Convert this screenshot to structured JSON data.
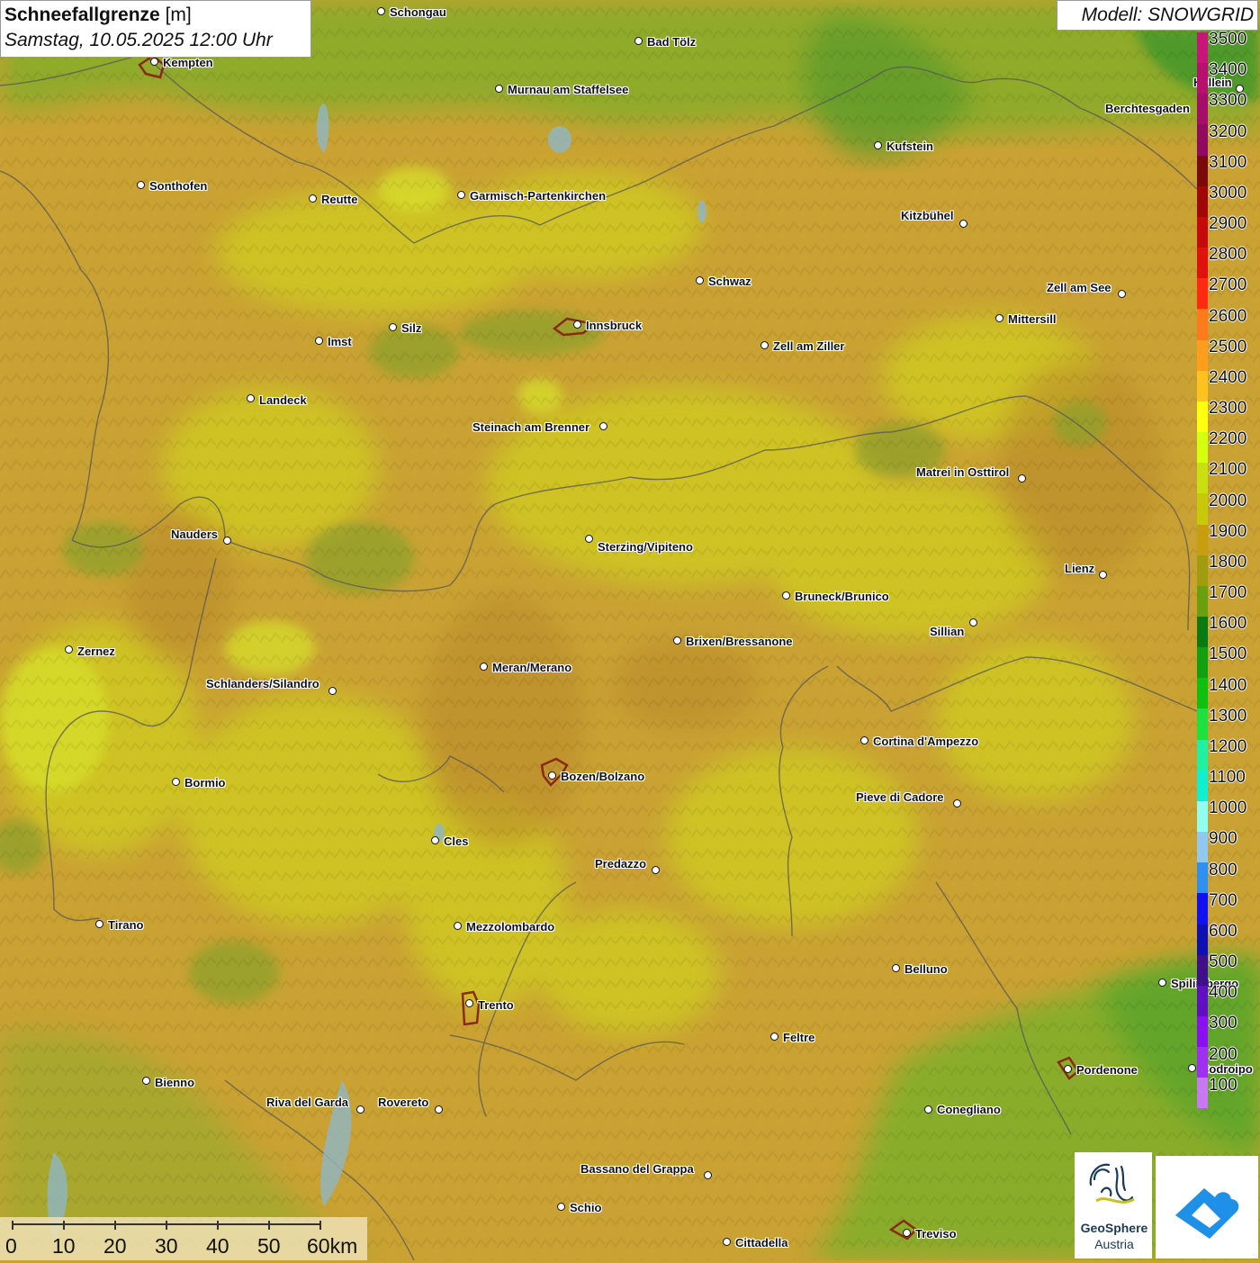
{
  "title": {
    "main": "Schneefallgrenze",
    "unit": "[m]",
    "datetime": "Samstag, 10.05.2025 12:00 Uhr"
  },
  "model_label": "Modell: SNOWGRID",
  "legend": {
    "levels": [
      {
        "value": "3500",
        "color": "#c8157a"
      },
      {
        "value": "3400",
        "color": "#b8106d"
      },
      {
        "value": "3300",
        "color": "#a50e68"
      },
      {
        "value": "3200",
        "color": "#8e0b5e"
      },
      {
        "value": "3100",
        "color": "#7a0a0a"
      },
      {
        "value": "3000",
        "color": "#a00808"
      },
      {
        "value": "2900",
        "color": "#c40a0a"
      },
      {
        "value": "2800",
        "color": "#e0120e"
      },
      {
        "value": "2700",
        "color": "#ff2a10"
      },
      {
        "value": "2600",
        "color": "#ff7a1a"
      },
      {
        "value": "2500",
        "color": "#ff9e1e"
      },
      {
        "value": "2400",
        "color": "#ffc21e"
      },
      {
        "value": "2300",
        "color": "#ffff10"
      },
      {
        "value": "2200",
        "color": "#d4ff10"
      },
      {
        "value": "2100",
        "color": "#c8e010"
      },
      {
        "value": "2000",
        "color": "#c8c80a"
      },
      {
        "value": "1900",
        "color": "#c89e10"
      },
      {
        "value": "1800",
        "color": "#a09c10"
      },
      {
        "value": "1700",
        "color": "#6aa010"
      },
      {
        "value": "1600",
        "color": "#0a7a10"
      },
      {
        "value": "1500",
        "color": "#10a010"
      },
      {
        "value": "1400",
        "color": "#10c010"
      },
      {
        "value": "1300",
        "color": "#20e040"
      },
      {
        "value": "1200",
        "color": "#20f0a0"
      },
      {
        "value": "1100",
        "color": "#10f0d0"
      },
      {
        "value": "1000",
        "color": "#90fff0"
      },
      {
        "value": "900",
        "color": "#90c8f0"
      },
      {
        "value": "800",
        "color": "#3090f0"
      },
      {
        "value": "700",
        "color": "#1010f0"
      },
      {
        "value": "600",
        "color": "#1010b0"
      },
      {
        "value": "500",
        "color": "#40108a"
      },
      {
        "value": "400",
        "color": "#6010c0"
      },
      {
        "value": "300",
        "color": "#8a10f0"
      },
      {
        "value": "200",
        "color": "#a030f0"
      },
      {
        "value": "100",
        "color": "#c878f0"
      }
    ]
  },
  "cities": [
    {
      "name": "Schongau",
      "dot": [
        424,
        13
      ],
      "label": [
        433,
        6
      ]
    },
    {
      "name": "Bad Tölz",
      "dot": [
        710,
        46
      ],
      "label": [
        719,
        39
      ]
    },
    {
      "name": "Kempten",
      "dot": [
        172,
        69
      ],
      "label": [
        181,
        62
      ]
    },
    {
      "name": "Murnau am Staffelsee",
      "dot": [
        555,
        99
      ],
      "label": [
        564,
        92
      ]
    },
    {
      "name": "Berchtesgaden",
      "dot": [
        1338,
        120
      ],
      "label": [
        1228,
        113
      ]
    },
    {
      "name": "Kufstein",
      "dot": [
        976,
        162
      ],
      "label": [
        985,
        155
      ]
    },
    {
      "name": "Sonthofen",
      "dot": [
        157,
        206
      ],
      "label": [
        166,
        199
      ]
    },
    {
      "name": "Reutte",
      "dot": [
        348,
        221
      ],
      "label": [
        357,
        214
      ]
    },
    {
      "name": "Garmisch-Partenkirchen",
      "dot": [
        513,
        217
      ],
      "label": [
        522,
        210
      ]
    },
    {
      "name": "Kitzbühel",
      "dot": [
        1071,
        249
      ],
      "label": [
        1001,
        232
      ]
    },
    {
      "name": "Schwaz",
      "dot": [
        778,
        312
      ],
      "label": [
        787,
        305
      ]
    },
    {
      "name": "Zell am See",
      "dot": [
        1247,
        327
      ],
      "label": [
        1163,
        312
      ]
    },
    {
      "name": "Mittersill",
      "dot": [
        1111,
        354
      ],
      "label": [
        1120,
        347
      ]
    },
    {
      "name": "Innsbruck",
      "dot": [
        642,
        361
      ],
      "label": [
        651,
        354
      ]
    },
    {
      "name": "Silz",
      "dot": [
        437,
        364
      ],
      "label": [
        446,
        357
      ]
    },
    {
      "name": "Imst",
      "dot": [
        355,
        379
      ],
      "label": [
        364,
        372
      ]
    },
    {
      "name": "Zell am Ziller",
      "dot": [
        850,
        384
      ],
      "label": [
        859,
        377
      ]
    },
    {
      "name": "Landeck",
      "dot": [
        279,
        443
      ],
      "label": [
        288,
        437
      ]
    },
    {
      "name": "Steinach am Brenner",
      "dot": [
        671,
        474
      ],
      "label": [
        525,
        467
      ]
    },
    {
      "name": "Matrei in Osttirol",
      "dot": [
        1136,
        532
      ],
      "label": [
        1018,
        517
      ]
    },
    {
      "name": "Nauders",
      "dot": [
        253,
        601
      ],
      "label": [
        190,
        586
      ]
    },
    {
      "name": "Sterzing/Vipiteno",
      "dot": [
        655,
        599
      ],
      "label": [
        664,
        600
      ]
    },
    {
      "name": "Lienz",
      "dot": [
        1226,
        639
      ],
      "label": [
        1183,
        624
      ]
    },
    {
      "name": "Bruneck/Brunico",
      "dot": [
        874,
        662
      ],
      "label": [
        883,
        655
      ]
    },
    {
      "name": "Sillian",
      "dot": [
        1082,
        692
      ],
      "label": [
        1033,
        694
      ]
    },
    {
      "name": "Brixen/Bressanone",
      "dot": [
        753,
        712
      ],
      "label": [
        762,
        705
      ]
    },
    {
      "name": "Zernez",
      "dot": [
        77,
        722
      ],
      "label": [
        86,
        716
      ]
    },
    {
      "name": "Meran/Merano",
      "dot": [
        538,
        741
      ],
      "label": [
        547,
        734
      ]
    },
    {
      "name": "Schlanders/Silandro",
      "dot": [
        370,
        768
      ],
      "label": [
        229,
        752
      ]
    },
    {
      "name": "Cortina d'Ampezzo",
      "dot": [
        961,
        823
      ],
      "label": [
        970,
        816
      ]
    },
    {
      "name": "Bozen/Bolzano",
      "dot": [
        614,
        862
      ],
      "label": [
        623,
        855
      ]
    },
    {
      "name": "Bormio",
      "dot": [
        196,
        869
      ],
      "label": [
        205,
        862
      ]
    },
    {
      "name": "Pieve di Cadore",
      "dot": [
        1064,
        893
      ],
      "label": [
        951,
        878
      ]
    },
    {
      "name": "Cles",
      "dot": [
        484,
        934
      ],
      "label": [
        493,
        927
      ]
    },
    {
      "name": "Predazzo",
      "dot": [
        729,
        967
      ],
      "label": [
        661,
        952
      ]
    },
    {
      "name": "Tirano",
      "dot": [
        111,
        1027
      ],
      "label": [
        120,
        1020
      ]
    },
    {
      "name": "Mezzolombardo",
      "dot": [
        509,
        1029
      ],
      "label": [
        518,
        1022
      ]
    },
    {
      "name": "Belluno",
      "dot": [
        996,
        1076
      ],
      "label": [
        1005,
        1069
      ]
    },
    {
      "name": "Spilimbergo",
      "dot": [
        1292,
        1092
      ],
      "label": [
        1301,
        1085
      ]
    },
    {
      "name": "Trento",
      "dot": [
        522,
        1115
      ],
      "label": [
        531,
        1109
      ]
    },
    {
      "name": "Feltre",
      "dot": [
        861,
        1152
      ],
      "label": [
        870,
        1145
      ]
    },
    {
      "name": "Pordenone",
      "dot": [
        1187,
        1188
      ],
      "label": [
        1196,
        1181
      ]
    },
    {
      "name": "Codroipo",
      "dot": [
        1325,
        1187
      ],
      "label": [
        1334,
        1180
      ]
    },
    {
      "name": "Bienno",
      "dot": [
        163,
        1201
      ],
      "label": [
        172,
        1195
      ]
    },
    {
      "name": "Riva del Garda",
      "dot": [
        401,
        1233
      ],
      "label": [
        296,
        1217
      ]
    },
    {
      "name": "Rovereto",
      "dot": [
        488,
        1233
      ],
      "label": [
        420,
        1217
      ]
    },
    {
      "name": "Conegliano",
      "dot": [
        1032,
        1233
      ],
      "label": [
        1041,
        1225
      ]
    },
    {
      "name": "Bassano del Grappa",
      "dot": [
        787,
        1306
      ],
      "label": [
        645,
        1291
      ]
    },
    {
      "name": "Schio",
      "dot": [
        624,
        1341
      ],
      "label": [
        633,
        1334
      ]
    },
    {
      "name": "Treviso",
      "dot": [
        1008,
        1370
      ],
      "label": [
        1017,
        1363
      ]
    },
    {
      "name": "Cittadella",
      "dot": [
        808,
        1380
      ],
      "label": [
        817,
        1373
      ]
    },
    {
      "name": "Hallein",
      "dot": [
        1378,
        99
      ],
      "label": [
        1326,
        84
      ]
    }
  ],
  "scale_bar": {
    "ticks": [
      "0",
      "10",
      "20",
      "30",
      "40",
      "50",
      "60km"
    ]
  },
  "logos": {
    "geosphere_line1": "GeoSphere",
    "geosphere_line2": "Austria"
  },
  "icons": {
    "geosphere": "geosphere-logo-icon",
    "cloud": "cloud-arrow-logo-icon"
  }
}
